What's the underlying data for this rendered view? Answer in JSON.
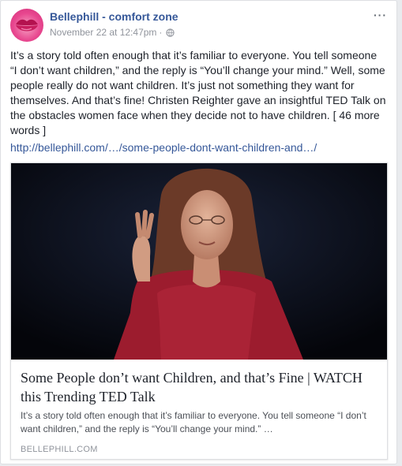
{
  "post": {
    "page_name": "Bellephill - comfort zone",
    "timestamp": "November 22 at 12:47pm",
    "separator": "·",
    "privacy_icon": "globe-icon",
    "more_options_icon": "ellipsis-icon",
    "more_options_label": "···",
    "text": "It’s a story told often enough that it’s familiar to everyone. You tell someone “I don’t want children,” and the reply is “You’ll change your mind.” Well, some people really do not want children. It’s just not something they want for themselves. And that’s fine! Christen Reighter gave an insightful TED Talk on the obstacles women face when they decide not to have children. [ 46 more words ]",
    "link": "http://bellephill.com/…/some-people-dont-want-children-and…/"
  },
  "attachment": {
    "image_alt": "Woman speaking on a dark stage",
    "title": "Some People don’t want Children, and that’s Fine | WATCH this Trending TED Talk",
    "description": "It’s a story told often enough that it’s familiar to everyone. You tell someone “I don’t want children,” and the reply is “You’ll change your mind.” …",
    "domain": "BELLEPHILL.COM"
  },
  "colors": {
    "link_blue": "#365899",
    "avatar_pink": "#e8478f",
    "text": "#1d2129",
    "muted": "#90949c"
  }
}
